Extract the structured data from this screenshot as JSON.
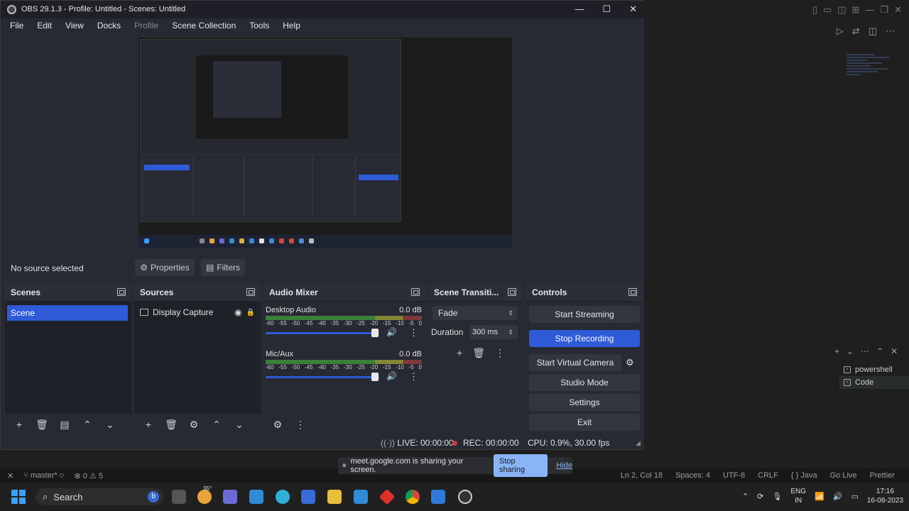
{
  "obs": {
    "title": "OBS 29.1.3 - Profile: Untitled - Scenes: Untitled",
    "window_controls": [
      "—",
      "☐",
      "✕"
    ],
    "menu": [
      "File",
      "Edit",
      "View",
      "Docks",
      "Profile",
      "Scene Collection",
      "Tools",
      "Help"
    ],
    "no_source": "No source selected",
    "properties_label": "Properties",
    "filters_label": "Filters",
    "docks": {
      "scenes": {
        "title": "Scenes",
        "items": [
          "Scene"
        ]
      },
      "sources": {
        "title": "Sources",
        "items": [
          "Display Capture"
        ]
      },
      "mixer": {
        "title": "Audio Mixer",
        "channels": [
          {
            "name": "Desktop Audio",
            "db": "0.0 dB",
            "volume_fraction": 0.96
          },
          {
            "name": "Mic/Aux",
            "db": "0.0 dB",
            "volume_fraction": 0.96
          }
        ],
        "scale": [
          "-60",
          "-55",
          "-50",
          "-45",
          "-40",
          "-35",
          "-30",
          "-25",
          "-20",
          "-15",
          "-10",
          "-5",
          "0"
        ]
      },
      "transitions": {
        "title": "Scene Transiti...",
        "selected": "Fade",
        "duration_label": "Duration",
        "duration_value": "300 ms"
      },
      "controls": {
        "title": "Controls",
        "start_streaming": "Start Streaming",
        "stop_recording": "Stop Recording",
        "start_virtual_camera": "Start Virtual Camera",
        "studio_mode": "Studio Mode",
        "settings": "Settings",
        "exit": "Exit"
      }
    },
    "status": {
      "live": "LIVE: 00:00:00",
      "rec": "REC: 00:00:00",
      "cpu": "CPU: 0.9%, 30.00 fps"
    }
  },
  "vscode": {
    "terminals": [
      "powershell",
      "Code"
    ],
    "status_left": {
      "branch": "master*",
      "errors": "0",
      "warnings": "5"
    },
    "status_right": [
      "Ln 2, Col 18",
      "Spaces: 4",
      "UTF-8",
      "CRLF",
      "{ } Java",
      "Go Live",
      "Prettier"
    ]
  },
  "share_bar": {
    "message": "meet.google.com is sharing your screen.",
    "stop_label": "Stop sharing",
    "hide_label": "Hide"
  },
  "taskbar": {
    "search_label": "Search",
    "weather": "35°",
    "lang_top": "ENG",
    "lang_bottom": "IN",
    "time": "17:16",
    "date": "16-08-2023"
  },
  "colors": {
    "accent": "#2f5bd8",
    "obs_bg": "#272a33",
    "rec_red": "#d83a3a"
  }
}
